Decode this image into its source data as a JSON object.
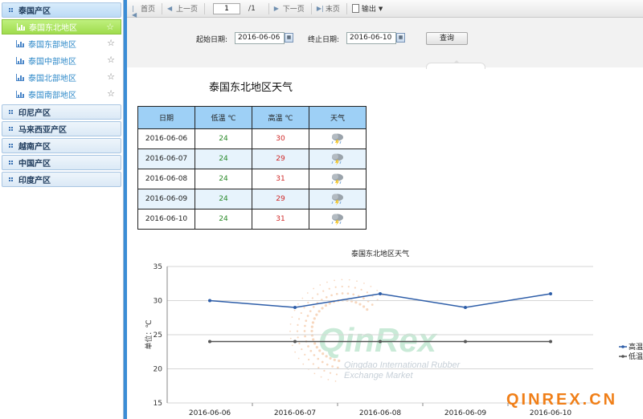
{
  "sidebar": {
    "regions": [
      {
        "label": "泰国产区",
        "subs": [
          {
            "label": "泰国东北地区"
          },
          {
            "label": "泰国东部地区"
          },
          {
            "label": "泰国中部地区"
          },
          {
            "label": "泰国北部地区"
          },
          {
            "label": "泰国南部地区"
          }
        ]
      },
      {
        "label": "印尼产区"
      },
      {
        "label": "马来西亚产区"
      },
      {
        "label": "越南产区"
      },
      {
        "label": "中国产区"
      },
      {
        "label": "印度产区"
      }
    ]
  },
  "toolbar": {
    "first": "首页",
    "prev": "上一页",
    "page": "1",
    "total": "/1",
    "next": "下一页",
    "last": "末页",
    "export": "输出"
  },
  "filter": {
    "start_label": "起始日期:",
    "start_value": "2016-06-06",
    "end_label": "终止日期:",
    "end_value": "2016-06-10",
    "query": "查询"
  },
  "table": {
    "title": "泰国东北地区天气",
    "headers": [
      "日期",
      "低温 ℃",
      "高温 ℃",
      "天气"
    ],
    "rows": [
      {
        "date": "2016-06-06",
        "low": "24",
        "high": "30"
      },
      {
        "date": "2016-06-07",
        "low": "24",
        "high": "29"
      },
      {
        "date": "2016-06-08",
        "low": "24",
        "high": "31"
      },
      {
        "date": "2016-06-09",
        "low": "24",
        "high": "29"
      },
      {
        "date": "2016-06-10",
        "low": "24",
        "high": "31"
      }
    ]
  },
  "chart_data": {
    "type": "line",
    "title": "泰国东北地区天气",
    "ylabel": "单位：℃",
    "categories": [
      "2016-06-06",
      "2016-06-07",
      "2016-06-08",
      "2016-06-09",
      "2016-06-10"
    ],
    "series": [
      {
        "name": "高温",
        "values": [
          30,
          29,
          31,
          29,
          31
        ],
        "color": "#2d5da8"
      },
      {
        "name": "低温",
        "values": [
          24,
          24,
          24,
          24,
          24
        ],
        "color": "#555555"
      }
    ],
    "yticks": [
      "35",
      "30",
      "25",
      "20",
      "15"
    ],
    "ylim": [
      15,
      35
    ],
    "grid": true,
    "legend": "right"
  },
  "watermark": {
    "logo": "QinRex",
    "tagline1": "Qingdao International Rubber",
    "tagline2": "Exchange Market",
    "site": "QINREX.CN"
  },
  "colors": {
    "accent": "#3b8dd6",
    "active_sub": "#9fdc4d",
    "header": "#9ed0f6",
    "low": "#2a8a2a",
    "high": "#d02a2a"
  }
}
